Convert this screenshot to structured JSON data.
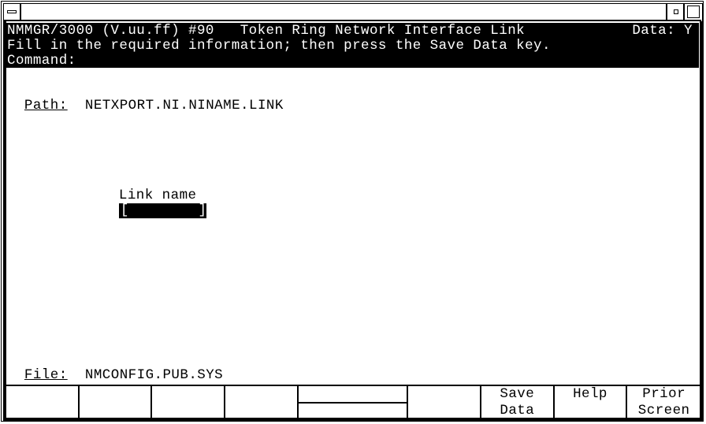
{
  "window": {
    "controls": {
      "system_menu_icon": "system-menu-icon",
      "minimize_icon": "minimize-icon",
      "maximize_icon": "maximize-icon"
    }
  },
  "header": {
    "title": "NMMGR/3000 (V.uu.ff) #90   Token Ring Network Interface Link",
    "data_flag": "Data: Y",
    "instruction": "Fill in the required information; then press the Save Data key.",
    "command_label": "Command:",
    "command_value": ""
  },
  "path": {
    "label": "Path:",
    "value": "NETXPORT.NI.NINAME.LINK"
  },
  "form": {
    "link_name_label": "Link name",
    "link_name_open": "[",
    "link_name_value": "        ",
    "link_name_close": "]"
  },
  "file": {
    "label": "File:",
    "value": "NMCONFIG.PUB.SYS"
  },
  "function_keys": [
    {
      "line1": "",
      "line2": ""
    },
    {
      "line1": "",
      "line2": ""
    },
    {
      "line1": "",
      "line2": ""
    },
    {
      "line1": "",
      "line2": ""
    },
    {
      "line1": "",
      "line2": ""
    },
    {
      "line1": "",
      "line2": ""
    },
    {
      "line1": "Save",
      "line2": "Data"
    },
    {
      "line1": "Help",
      "line2": ""
    },
    {
      "line1": "Prior",
      "line2": "Screen"
    }
  ]
}
